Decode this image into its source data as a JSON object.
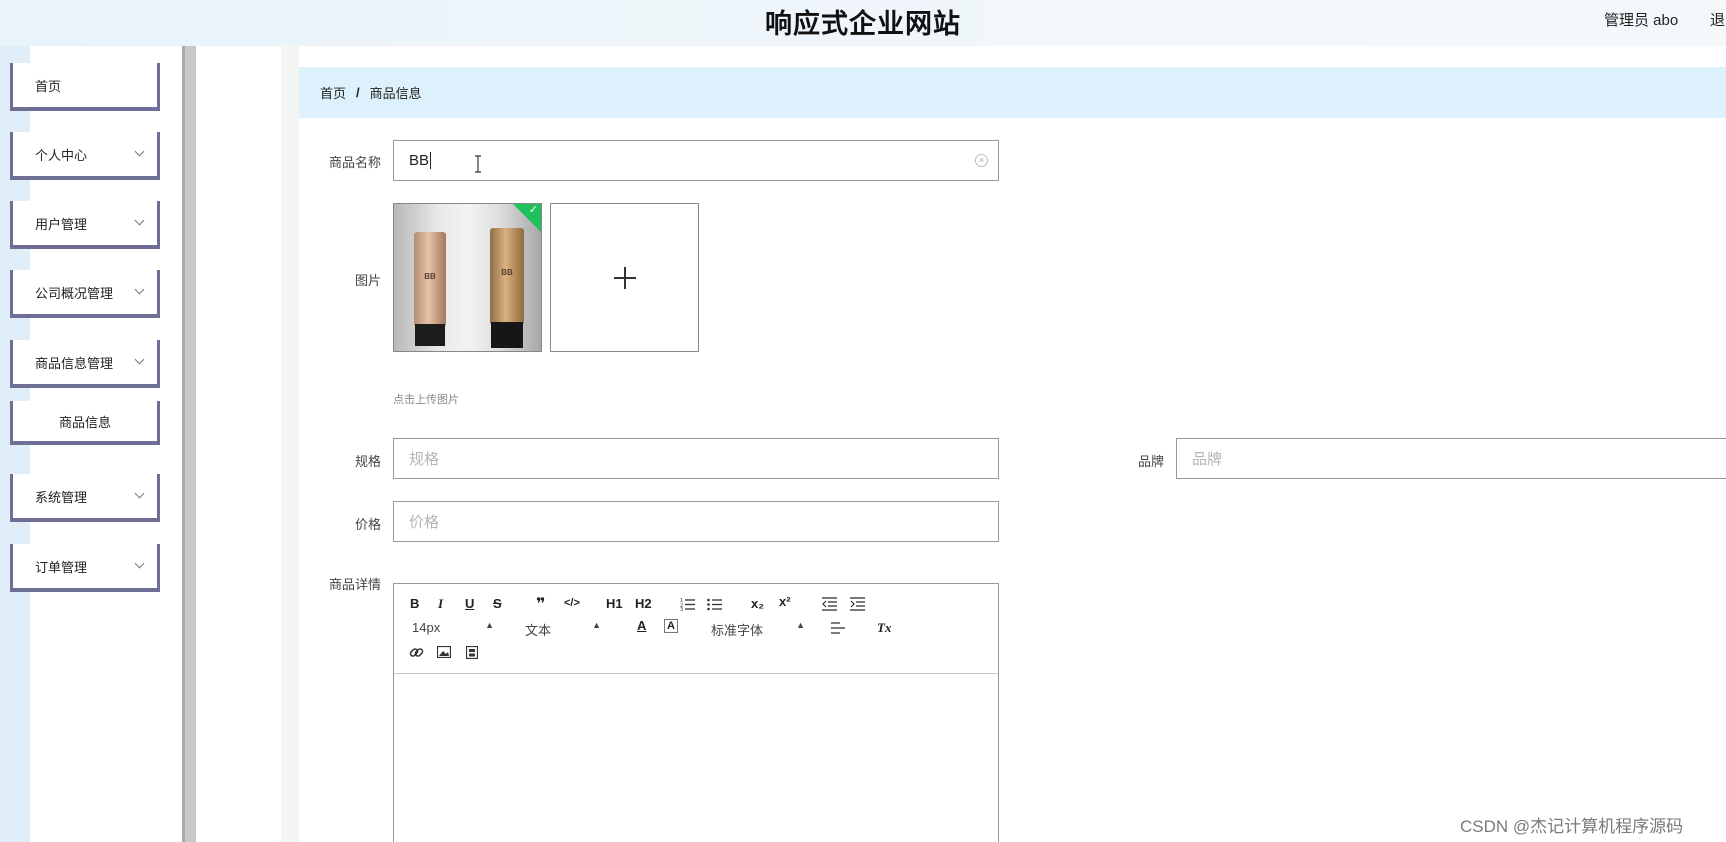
{
  "header": {
    "site_title": "响应式企业网站",
    "user_label": "管理员 abo",
    "logout_label": "退"
  },
  "sidebar": {
    "items": [
      {
        "label": "首页",
        "has_arrow": false
      },
      {
        "label": "个人中心",
        "has_arrow": true
      },
      {
        "label": "用户管理",
        "has_arrow": true
      },
      {
        "label": "公司概况管理",
        "has_arrow": true
      },
      {
        "label": "商品信息管理",
        "has_arrow": true
      },
      {
        "label": "商品信息",
        "has_arrow": false,
        "submenu": true
      },
      {
        "label": "系统管理",
        "has_arrow": true
      },
      {
        "label": "订单管理",
        "has_arrow": true
      }
    ]
  },
  "breadcrumb": {
    "home": "首页",
    "separator": "/",
    "current": "商品信息"
  },
  "form": {
    "name_label": "商品名称",
    "name_value": "BB",
    "image_label": "图片",
    "image_icon": "bb-cream-product-photo",
    "upload_hint": "点击上传图片",
    "spec_label": "规格",
    "spec_placeholder": "规格",
    "brand_label": "品牌",
    "brand_placeholder": "品牌",
    "price_label": "价格",
    "price_placeholder": "价格",
    "detail_label": "商品详情"
  },
  "editor": {
    "font_size_value": "14px",
    "text_type_value": "文本",
    "font_family_value": "标准字体",
    "buttons": {
      "bold": "B",
      "italic": "I",
      "underline": "U",
      "strike": "S",
      "quote": "❞",
      "code": "</>",
      "h1": "H1",
      "h2": "H2",
      "sub": "x₂",
      "sup": "x²",
      "color": "A",
      "bg_color": "A",
      "clear": "Tx"
    }
  },
  "colors": {
    "menu_border": "#6f6e96",
    "breadcrumb_bg": "#dcf1fb",
    "sidebar_bg": "#dfeef8",
    "upload_success": "#20c05c"
  },
  "watermark": "CSDN @杰记计算机程序源码"
}
